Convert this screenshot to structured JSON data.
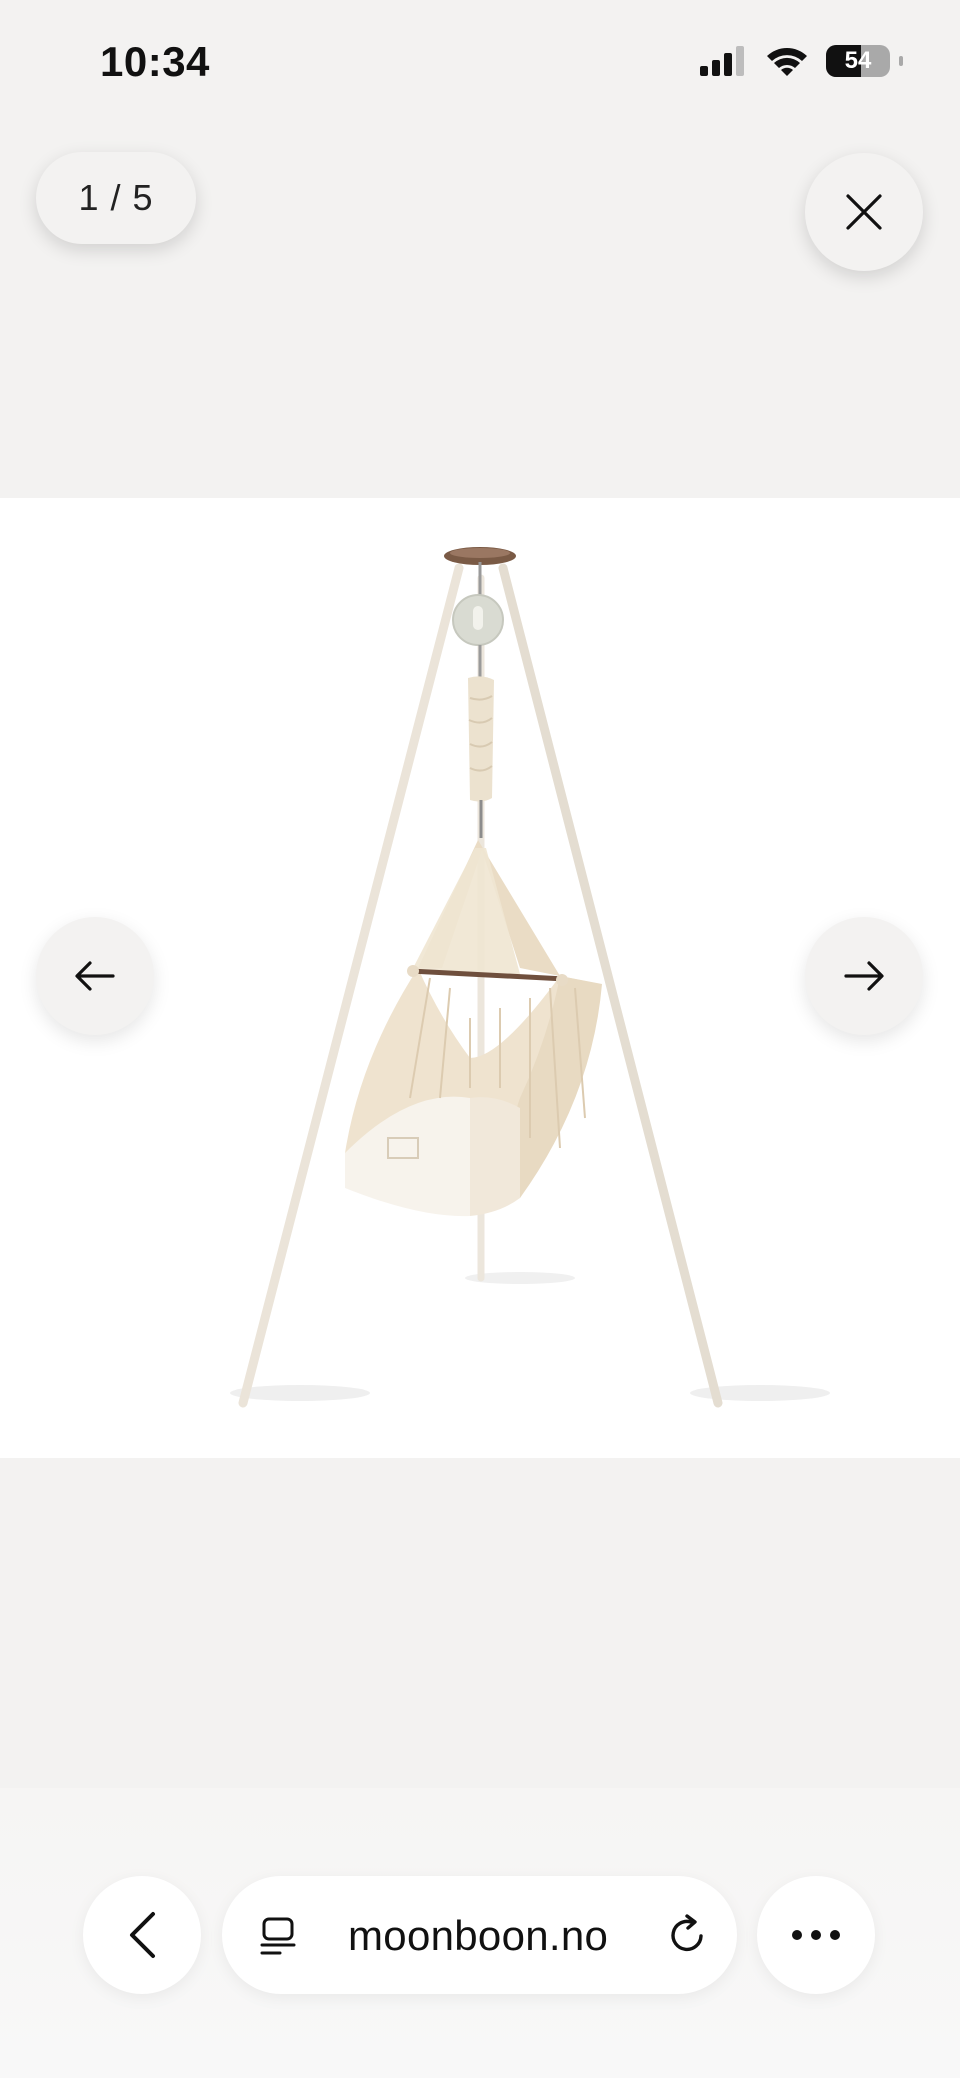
{
  "status_bar": {
    "time": "10:34",
    "battery_level": "54",
    "battery_fraction": 0.54
  },
  "gallery": {
    "counter": "1 / 5",
    "close_icon": "close-icon",
    "prev_icon": "arrow-left-icon",
    "next_icon": "arrow-right-icon",
    "image_subject": "baby hammock on tripod stand"
  },
  "browser": {
    "url": "moonboon.no",
    "back_icon": "chevron-left-icon",
    "tabs_icon": "tabs-icon",
    "reload_icon": "reload-icon",
    "more_icon": "more-icon"
  },
  "colors": {
    "background": "#f3f2f1",
    "image_background": "#ffffff",
    "stand": "#ece6dc",
    "fabric": "#efe3cf",
    "wood": "#7a5a45"
  }
}
